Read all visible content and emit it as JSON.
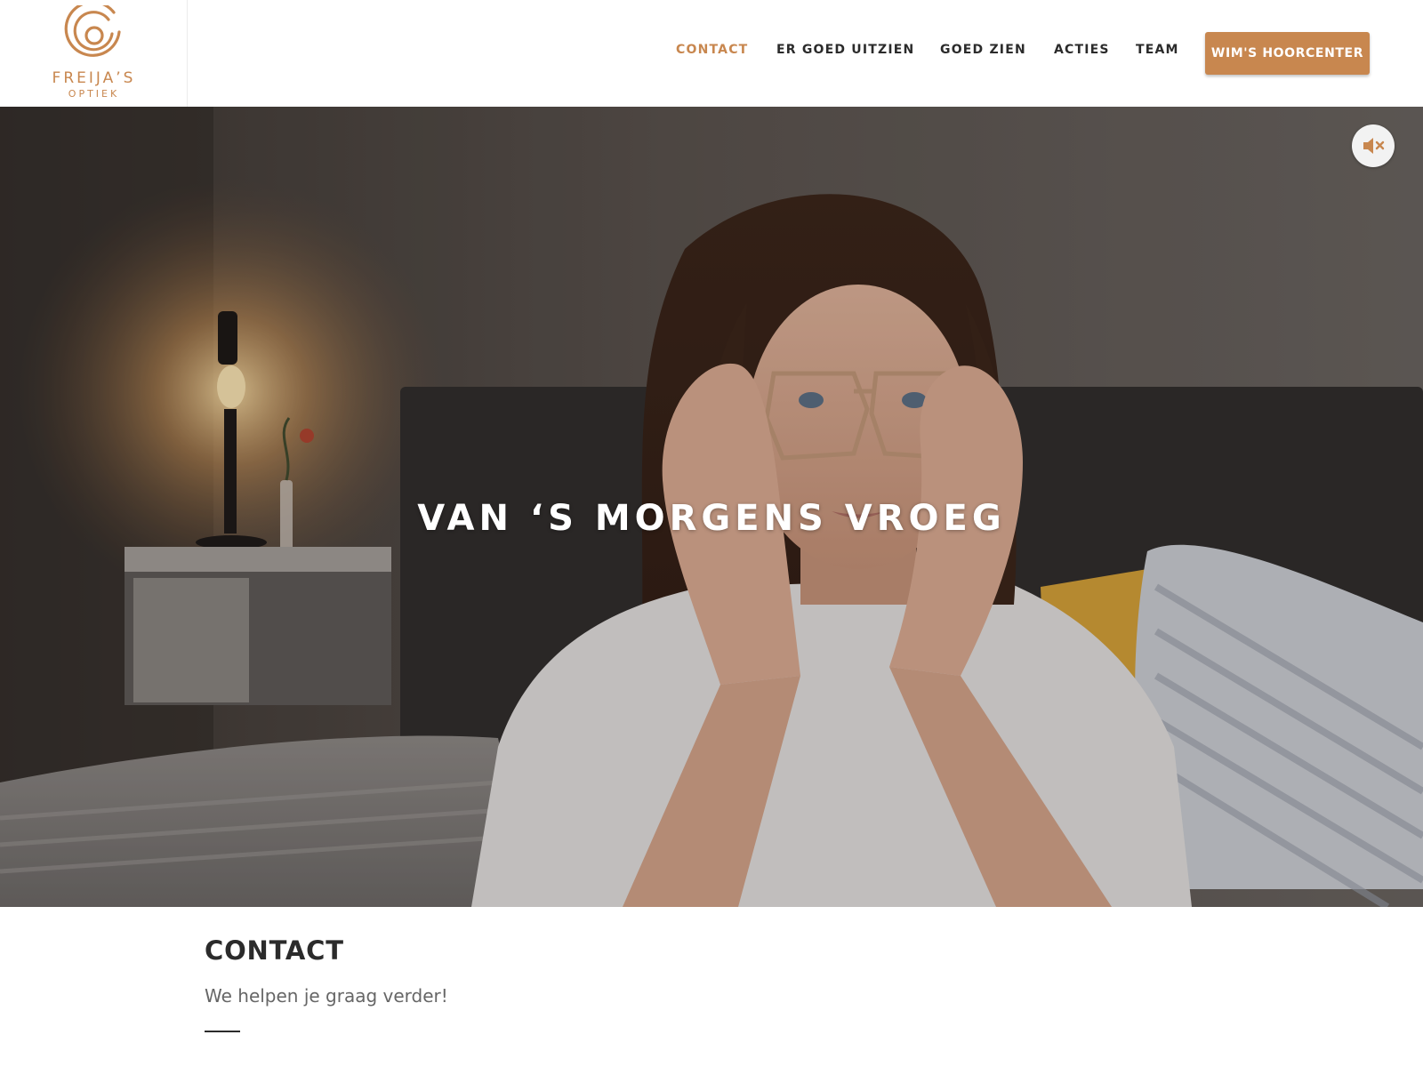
{
  "brand": {
    "name": "FREIJA’S",
    "subtitle": "OPTIEK",
    "logo_icon": "concentric-circles-icon",
    "accent_color": "#c8874f"
  },
  "nav": {
    "items": [
      {
        "label": "CONTACT",
        "active": true
      },
      {
        "label": "ER GOED UITZIEN",
        "active": false
      },
      {
        "label": "GOED ZIEN",
        "active": false
      },
      {
        "label": "ACTIES",
        "active": false
      },
      {
        "label": "TEAM",
        "active": false
      }
    ],
    "cta_label": "WIM'S HOORCENTER"
  },
  "hero": {
    "title": "VAN ‘S MORGENS VROEG",
    "mute_icon": "speaker-muted-icon"
  },
  "contact": {
    "title": "CONTACT",
    "subtitle": "We helpen je graag verder!"
  }
}
